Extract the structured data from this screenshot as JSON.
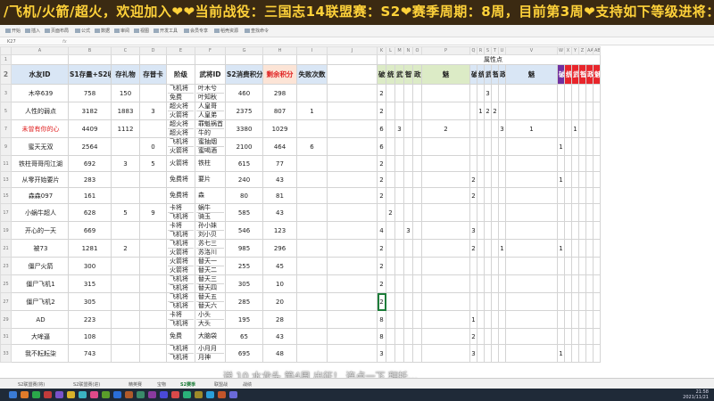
{
  "banner": {
    "text": "/飞机/火箭/超火，欢迎加入❤❤当前战役：三国志14联盟赛：S2❤赛季周期：8周，目前第3周❤支持如下等级进将：免"
  },
  "toolbar": {
    "items": [
      "开始",
      "插入",
      "页面布局",
      "公式",
      "数据",
      "审阅",
      "视图",
      "开发工具",
      "会员专享",
      "稻壳资源",
      "查找命令"
    ],
    "namebox": "K27",
    "fx": "fx"
  },
  "columns": [
    "A",
    "B",
    "C",
    "D",
    "E",
    "F",
    "G",
    "H",
    "I",
    "J",
    "K",
    "L",
    "M",
    "N",
    "O",
    "P",
    "Q",
    "R",
    "S",
    "T",
    "U",
    "V",
    "W",
    "X",
    "Y",
    "Z",
    "AA",
    "AB"
  ],
  "headers": {
    "merged_attr": "属性点",
    "r2": [
      "水友ID",
      "S1存量+S2收入",
      "存礼物",
      "存普卡",
      "阶级",
      "武将ID",
      "S2消费积分",
      "剩余积分",
      "失败次数"
    ],
    "groups": [
      "破境珠（凡）",
      "破境珠（精）",
      "破境珠（英）"
    ],
    "attrs": [
      "统",
      "武",
      "智",
      "政",
      "魅"
    ]
  },
  "row_numbers": [
    "1",
    "2",
    "3",
    "4",
    "5",
    "6",
    "7",
    "8",
    "9",
    "10",
    "11",
    "12",
    "13",
    "14",
    "15",
    "16",
    "17",
    "18",
    "19",
    "20",
    "21",
    "22",
    "23",
    "24",
    "25",
    "26",
    "27",
    "28",
    "29",
    "30",
    "31",
    "32",
    "33",
    "34",
    "35",
    "36"
  ],
  "rows": [
    {
      "id": "木卒639",
      "b": "758",
      "c": "150",
      "d": "",
      "e": [
        "飞机将",
        "免费"
      ],
      "f": [
        "叶木兮",
        "叶知秋"
      ],
      "g": "460",
      "h": "298",
      "i": "",
      "k": "2",
      "extra": {
        "S": "3"
      }
    },
    {
      "id": "人性的弱点",
      "b": "3182",
      "c": "1883",
      "d": "3",
      "e": [
        "超火将",
        "火箭将"
      ],
      "f": [
        "人皇哥",
        "人皇弟"
      ],
      "g": "2375",
      "h": "807",
      "i": "1",
      "k": "2",
      "extra": {
        "R": "1",
        "S": "2",
        "T": "2"
      }
    },
    {
      "id": "未曾有你的心",
      "red": true,
      "b": "4409",
      "c": "1112",
      "d": "",
      "e": [
        "超火将",
        "超火将"
      ],
      "f": [
        "罪魁祸首",
        "牛的"
      ],
      "g": "3380",
      "h": "1029",
      "i": "",
      "k": "6",
      "extra": {
        "M": "3",
        "P": "2",
        "U": "3",
        "V": "1",
        "Y": "1"
      }
    },
    {
      "id": "蜜天无双",
      "b": "2564",
      "c": "",
      "d": "0",
      "e": [
        "飞机将",
        "火箭将"
      ],
      "f": [
        "蜜抽烟",
        "蜜喝酒"
      ],
      "g": "2100",
      "h": "464",
      "i": "6",
      "k": "6",
      "extra": {
        "W": "1"
      }
    },
    {
      "id": "铁柱哥哥闯江湖",
      "b": "692",
      "c": "3",
      "d": "5",
      "e": [
        "火箭将"
      ],
      "f": [
        "铁柱"
      ],
      "g": "615",
      "h": "77",
      "i": "",
      "k": "2",
      "extra": {}
    },
    {
      "id": "从零开始要片",
      "b": "283",
      "c": "",
      "d": "",
      "e": [
        "免费将"
      ],
      "f": [
        "要片"
      ],
      "g": "240",
      "h": "43",
      "i": "",
      "k": "2",
      "extra": {
        "Q": "2",
        "W": "1"
      }
    },
    {
      "id": "森森097",
      "b": "161",
      "c": "",
      "d": "",
      "e": [
        "免费将"
      ],
      "f": [
        "森"
      ],
      "g": "80",
      "h": "81",
      "i": "",
      "k": "2",
      "extra": {
        "Q": "2"
      }
    },
    {
      "id": "小蜗牛超人",
      "b": "628",
      "c": "5",
      "d": "9",
      "e": [
        "卡将",
        "飞机将"
      ],
      "f": [
        "蜗牛",
        "骑玉"
      ],
      "g": "585",
      "h": "43",
      "i": "",
      "k": "",
      "extra": {
        "L": "2"
      }
    },
    {
      "id": "开心的一天",
      "b": "669",
      "c": "",
      "d": "",
      "e": [
        "卡将",
        "飞机将"
      ],
      "f": [
        "孙小妹",
        "刘小贝"
      ],
      "g": "546",
      "h": "123",
      "i": "",
      "k": "4",
      "extra": {
        "N": "3",
        "Q": "3"
      }
    },
    {
      "id": "被73",
      "b": "1281",
      "c": "2",
      "d": "",
      "e": [
        "飞机将",
        "火箭将"
      ],
      "f": [
        "苏七三",
        "苏洛川"
      ],
      "g": "985",
      "h": "296",
      "i": "",
      "k": "2",
      "extra": {
        "Q": "2",
        "U": "1",
        "W": "1"
      }
    },
    {
      "id": "僵尸火箭",
      "b": "300",
      "c": "",
      "d": "",
      "e": [
        "火箭将",
        "火箭将"
      ],
      "f": [
        "替天一",
        "替天二"
      ],
      "g": "255",
      "h": "45",
      "i": "",
      "k": "2",
      "extra": {}
    },
    {
      "id": "僵尸飞机1",
      "b": "315",
      "c": "",
      "d": "",
      "e": [
        "飞机将",
        "飞机将"
      ],
      "f": [
        "替天三",
        "替天四"
      ],
      "g": "305",
      "h": "10",
      "i": "",
      "k": "2",
      "extra": {}
    },
    {
      "id": "僵尸飞机2",
      "b": "305",
      "c": "",
      "d": "",
      "e": [
        "飞机将",
        "飞机将"
      ],
      "f": [
        "替天五",
        "替天六"
      ],
      "g": "285",
      "h": "20",
      "i": "",
      "k": "2",
      "sel": true,
      "extra": {}
    },
    {
      "id": "AD",
      "b": "223",
      "c": "",
      "d": "",
      "e": [
        "卡将",
        "飞机将"
      ],
      "f": [
        "小头",
        "大头"
      ],
      "g": "195",
      "h": "28",
      "i": "",
      "k": "8",
      "extra": {
        "Q": "1"
      }
    },
    {
      "id": "大哞逼",
      "b": "108",
      "c": "",
      "d": "",
      "e": [
        "免费"
      ],
      "f": [
        "大脑袋"
      ],
      "g": "65",
      "h": "43",
      "i": "",
      "k": "8",
      "extra": {
        "Q": "2"
      }
    },
    {
      "id": "我不耘耘柒",
      "b": "743",
      "c": "",
      "d": "",
      "e": [
        "飞机将",
        "飞机将"
      ],
      "f": [
        "小月月",
        "月神"
      ],
      "g": "695",
      "h": "48",
      "i": "",
      "k": "3",
      "extra": {
        "Q": "3",
        "W": "1"
      }
    }
  ],
  "sheets": [
    "S2联盟赛(将)",
    "S2联盟赛(进)",
    "精英赛",
    "宝物",
    "S2赛季",
    "联盟战",
    "战绩"
  ],
  "active_sheet": "S2赛季",
  "danmu": "送 10 水龙头 第4周 出征！ 连点一下 拜托…",
  "clock": {
    "time": "21:58",
    "date": "2021/11/21"
  },
  "colors": {
    "banner_bg": "#3b2a12",
    "banner_text": "#ffd23a",
    "accent": "#1e7d3a"
  }
}
